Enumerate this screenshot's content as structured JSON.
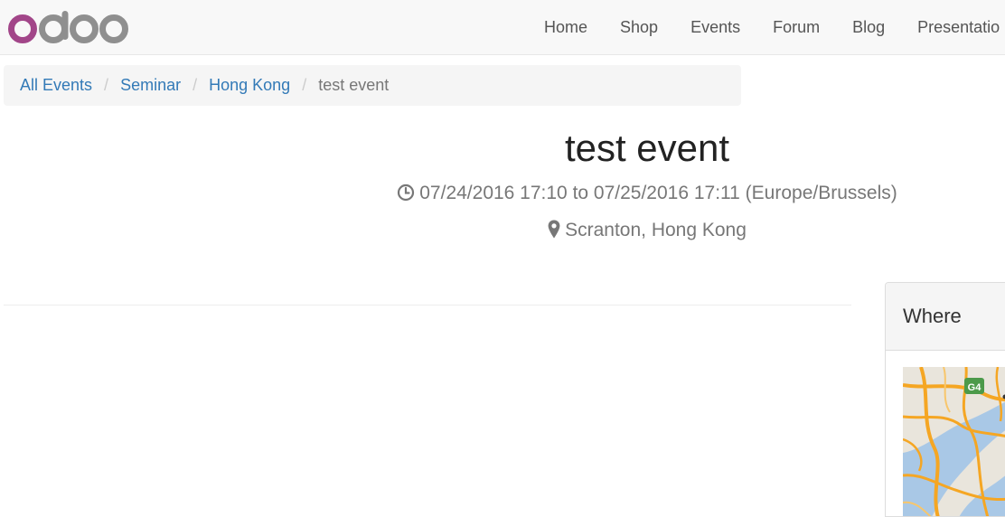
{
  "brand": {
    "logo_icon": "odoo-logo",
    "logo_colors": [
      "#a24689",
      "#8f8f8f"
    ]
  },
  "nav": {
    "items": [
      {
        "label": "Home"
      },
      {
        "label": "Shop"
      },
      {
        "label": "Events"
      },
      {
        "label": "Forum"
      },
      {
        "label": "Blog"
      },
      {
        "label": "Presentatio"
      }
    ]
  },
  "breadcrumb": {
    "items": [
      "All Events",
      "Seminar",
      "Hong Kong"
    ],
    "active": "test event"
  },
  "event": {
    "title": "test event",
    "date_icon": "clock-icon",
    "date_text": "07/24/2016 17:10 to 07/25/2016 17:11 (Europe/Brussels)",
    "location_icon": "map-marker-icon",
    "location_text": "Scranton, Hong Kong"
  },
  "where": {
    "heading": "Where",
    "map_badge": "G4"
  },
  "colors": {
    "link": "#337ab7",
    "muted": "#777777",
    "map_road": "#f5a623",
    "map_water": "#a9c8e6"
  }
}
